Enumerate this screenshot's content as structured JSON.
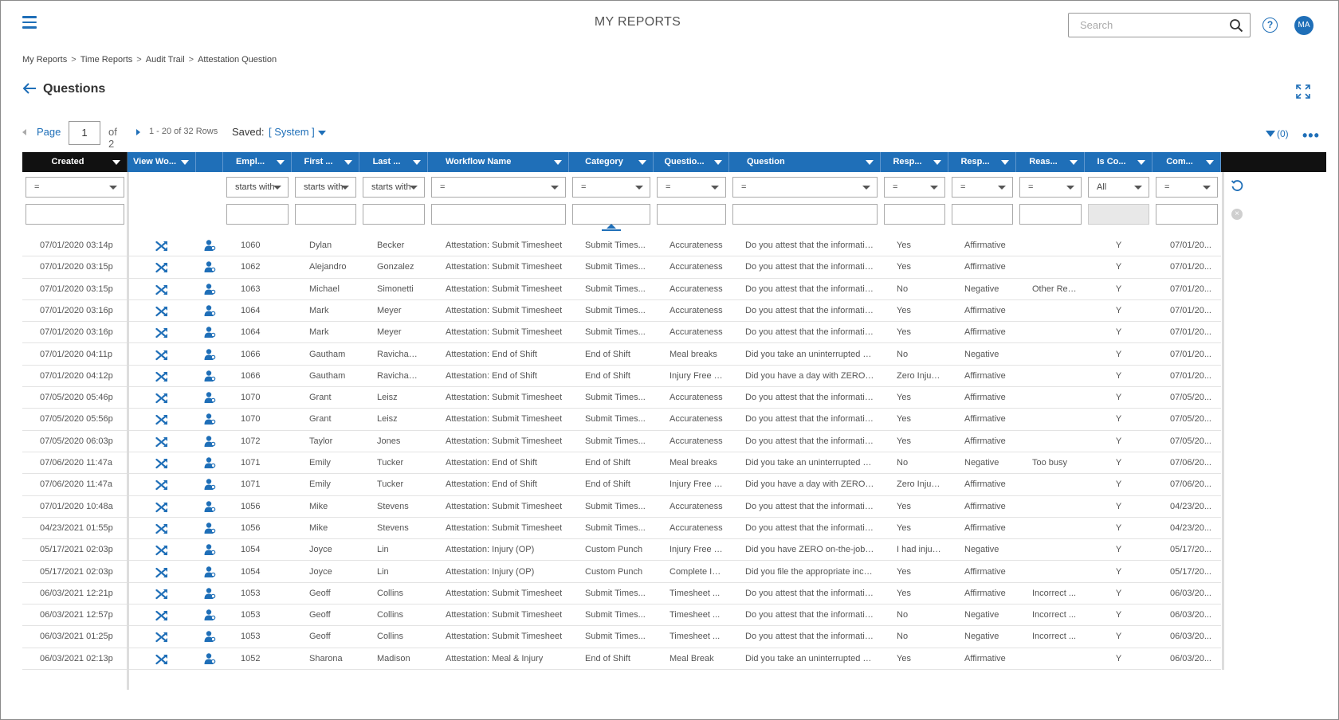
{
  "app": {
    "title": "MY REPORTS",
    "avatar_initials": "MA"
  },
  "search": {
    "placeholder": "Search"
  },
  "breadcrumb": [
    "My Reports",
    "Time Reports",
    "Audit Trail",
    "Attestation Question"
  ],
  "page": {
    "heading": "Questions"
  },
  "pager": {
    "page_label": "Page",
    "current_page": "1",
    "of_label": "of 2",
    "rows_label": "1 - 20 of 32 Rows",
    "saved_label": "Saved:",
    "saved_value": "[ System ]",
    "filter_count": "(0)"
  },
  "columns": [
    {
      "label": "Created",
      "filter_op": "=",
      "text_filter": true
    },
    {
      "label": "View Wo...",
      "filter_op": "",
      "text_filter": false
    },
    {
      "label": "",
      "filter_op": "",
      "text_filter": false
    },
    {
      "label": "Empl...",
      "filter_op": "starts with",
      "text_filter": true
    },
    {
      "label": "First ...",
      "filter_op": "starts with",
      "text_filter": true
    },
    {
      "label": "Last ...",
      "filter_op": "starts with",
      "text_filter": true
    },
    {
      "label": "Workflow Name",
      "filter_op": "=",
      "text_filter": true
    },
    {
      "label": "Category",
      "filter_op": "=",
      "text_filter": true
    },
    {
      "label": "Questio...",
      "filter_op": "=",
      "text_filter": true
    },
    {
      "label": "Question",
      "filter_op": "=",
      "text_filter": true
    },
    {
      "label": "Resp...",
      "filter_op": "=",
      "text_filter": true
    },
    {
      "label": "Resp...",
      "filter_op": "=",
      "text_filter": true
    },
    {
      "label": "Reas...",
      "filter_op": "=",
      "text_filter": true
    },
    {
      "label": "Is Co...",
      "filter_op": "All",
      "text_filter": true
    },
    {
      "label": "Com...",
      "filter_op": "=",
      "text_filter": true
    }
  ],
  "rows": [
    [
      "07/01/2020 03:14p",
      "1060",
      "Dylan",
      "Becker",
      "Attestation: Submit Timesheet",
      "Submit Times...",
      "Accurateness",
      "Do you attest that the information...",
      "Yes",
      "Affirmative",
      "",
      "Y",
      "07/01/20..."
    ],
    [
      "07/01/2020 03:15p",
      "1062",
      "Alejandro",
      "Gonzalez",
      "Attestation: Submit Timesheet",
      "Submit Times...",
      "Accurateness",
      "Do you attest that the information...",
      "Yes",
      "Affirmative",
      "",
      "Y",
      "07/01/20..."
    ],
    [
      "07/01/2020 03:15p",
      "1063",
      "Michael",
      "Simonetti",
      "Attestation: Submit Timesheet",
      "Submit Times...",
      "Accurateness",
      "Do you attest that the information...",
      "No",
      "Negative",
      "Other Rea...",
      "Y",
      "07/01/20..."
    ],
    [
      "07/01/2020 03:16p",
      "1064",
      "Mark",
      "Meyer",
      "Attestation: Submit Timesheet",
      "Submit Times...",
      "Accurateness",
      "Do you attest that the information...",
      "Yes",
      "Affirmative",
      "",
      "Y",
      "07/01/20..."
    ],
    [
      "07/01/2020 03:16p",
      "1064",
      "Mark",
      "Meyer",
      "Attestation: Submit Timesheet",
      "Submit Times...",
      "Accurateness",
      "Do you attest that the information...",
      "Yes",
      "Affirmative",
      "",
      "Y",
      "07/01/20..."
    ],
    [
      "07/01/2020 04:11p",
      "1066",
      "Gautham",
      "Ravichand...",
      "Attestation: End of Shift",
      "End of Shift",
      "Meal breaks",
      "Did you take an uninterrupted me...",
      "No",
      "Negative",
      "",
      "Y",
      "07/01/20..."
    ],
    [
      "07/01/2020 04:12p",
      "1066",
      "Gautham",
      "Ravichand...",
      "Attestation: End of Shift",
      "End of Shift",
      "Injury Free D...",
      "Did you have a day with ZERO on-...",
      "Zero Injuri...",
      "Affirmative",
      "",
      "Y",
      "07/01/20..."
    ],
    [
      "07/05/2020 05:46p",
      "1070",
      "Grant",
      "Leisz",
      "Attestation: Submit Timesheet",
      "Submit Times...",
      "Accurateness",
      "Do you attest that the information...",
      "Yes",
      "Affirmative",
      "",
      "Y",
      "07/05/20..."
    ],
    [
      "07/05/2020 05:56p",
      "1070",
      "Grant",
      "Leisz",
      "Attestation: Submit Timesheet",
      "Submit Times...",
      "Accurateness",
      "Do you attest that the information...",
      "Yes",
      "Affirmative",
      "",
      "Y",
      "07/05/20..."
    ],
    [
      "07/05/2020 06:03p",
      "1072",
      "Taylor",
      "Jones",
      "Attestation: Submit Timesheet",
      "Submit Times...",
      "Accurateness",
      "Do you attest that the information...",
      "Yes",
      "Affirmative",
      "",
      "Y",
      "07/05/20..."
    ],
    [
      "07/06/2020 11:47a",
      "1071",
      "Emily",
      "Tucker",
      "Attestation: End of Shift",
      "End of Shift",
      "Meal breaks",
      "Did you take an uninterrupted me...",
      "No",
      "Negative",
      "Too busy",
      "Y",
      "07/06/20..."
    ],
    [
      "07/06/2020 11:47a",
      "1071",
      "Emily",
      "Tucker",
      "Attestation: End of Shift",
      "End of Shift",
      "Injury Free D...",
      "Did you have a day with ZERO on-...",
      "Zero Injuri...",
      "Affirmative",
      "",
      "Y",
      "07/06/20..."
    ],
    [
      "07/01/2020 10:48a",
      "1056",
      "Mike",
      "Stevens",
      "Attestation: Submit Timesheet",
      "Submit Times...",
      "Accurateness",
      "Do you attest that the information...",
      "Yes",
      "Affirmative",
      "",
      "Y",
      "04/23/20..."
    ],
    [
      "04/23/2021 01:55p",
      "1056",
      "Mike",
      "Stevens",
      "Attestation: Submit Timesheet",
      "Submit Times...",
      "Accurateness",
      "Do you attest that the information...",
      "Yes",
      "Affirmative",
      "",
      "Y",
      "04/23/20..."
    ],
    [
      "05/17/2021 02:03p",
      "1054",
      "Joyce",
      "Lin",
      "Attestation: Injury (OP)",
      "Custom Punch",
      "Injury Free D...",
      "Did you have ZERO on-the-job inju...",
      "I had injuri...",
      "Negative",
      "",
      "Y",
      "05/17/20..."
    ],
    [
      "05/17/2021 02:03p",
      "1054",
      "Joyce",
      "Lin",
      "Attestation: Injury (OP)",
      "Custom Punch",
      "Complete In...",
      "Did you file the appropriate incide...",
      "Yes",
      "Affirmative",
      "",
      "Y",
      "05/17/20..."
    ],
    [
      "06/03/2021 12:21p",
      "1053",
      "Geoff",
      "Collins",
      "Attestation: Submit Timesheet",
      "Submit Times...",
      "Timesheet ...",
      "Do you attest that the information...",
      "Yes",
      "Affirmative",
      "Incorrect ...",
      "Y",
      "06/03/20..."
    ],
    [
      "06/03/2021 12:57p",
      "1053",
      "Geoff",
      "Collins",
      "Attestation: Submit Timesheet",
      "Submit Times...",
      "Timesheet ...",
      "Do you attest that the information...",
      "No",
      "Negative",
      "Incorrect ...",
      "Y",
      "06/03/20..."
    ],
    [
      "06/03/2021 01:25p",
      "1053",
      "Geoff",
      "Collins",
      "Attestation: Submit Timesheet",
      "Submit Times...",
      "Timesheet ...",
      "Do you attest that the information...",
      "No",
      "Negative",
      "Incorrect ...",
      "Y",
      "06/03/20..."
    ],
    [
      "06/03/2021 02:13p",
      "1052",
      "Sharona",
      "Madison",
      "Attestation: Meal & Injury",
      "End of Shift",
      "Meal Break",
      "Did you take an uninterrupted me...",
      "Yes",
      "Affirmative",
      "",
      "Y",
      "06/03/20..."
    ]
  ],
  "icons": {
    "menu": "hamburger-icon",
    "search": "search-icon",
    "help": "help-icon",
    "back": "back-arrow-icon",
    "expand": "expand-icon",
    "filter": "funnel-icon",
    "more": "more-icon",
    "workflow": "shuffle-icon",
    "employee": "employee-icon",
    "refresh": "refresh-icon",
    "clear": "clear-icon"
  },
  "colors": {
    "accent": "#1f6fb8",
    "header_dark": "#111111"
  }
}
